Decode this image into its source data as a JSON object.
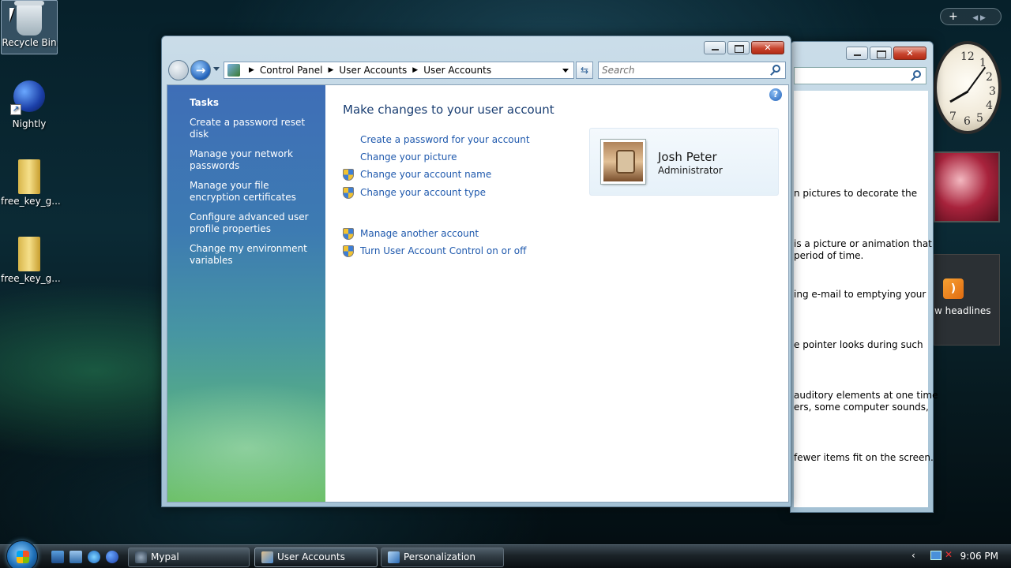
{
  "desktop": {
    "icons": [
      {
        "label": "Recycle Bin"
      },
      {
        "label": "Nightly"
      },
      {
        "label": "free_key_g..."
      },
      {
        "label": "free_key_g..."
      }
    ]
  },
  "gadgets": {
    "add_symbol": "+",
    "clock_numbers": [
      "12",
      "1",
      "2",
      "3",
      "4",
      "5",
      "6",
      "7"
    ],
    "feed_label": "w headlines"
  },
  "background_window": {
    "snippets": [
      "n pictures to decorate the",
      "is a picture or animation that",
      " period of time.",
      "ing e-mail to emptying your",
      "e pointer looks during such",
      "auditory elements at one time",
      "ers, some computer sounds,",
      "fewer items fit on the screen."
    ]
  },
  "main_window": {
    "breadcrumb": [
      "Control Panel",
      "User Accounts",
      "User Accounts"
    ],
    "search_placeholder": "Search",
    "help_symbol": "?",
    "tasks": {
      "heading": "Tasks",
      "links": [
        "Create a password reset disk",
        "Manage your network passwords",
        "Manage your file encryption certificates",
        "Configure advanced user profile properties",
        "Change my environment variables"
      ]
    },
    "heading": "Make changes to your user account",
    "links": [
      {
        "label": "Create a password for your account",
        "shield": false
      },
      {
        "label": "Change your picture",
        "shield": false
      },
      {
        "label": "Change your account name",
        "shield": true
      },
      {
        "label": "Change your account type",
        "shield": true
      }
    ],
    "links2": [
      {
        "label": "Manage another account",
        "shield": true
      },
      {
        "label": "Turn User Account Control on or off",
        "shield": true
      }
    ],
    "user": {
      "name": "Josh Peter",
      "role": "Administrator"
    }
  },
  "taskbar": {
    "buttons": [
      {
        "label": "Mypal",
        "active": false
      },
      {
        "label": "User Accounts",
        "active": true
      },
      {
        "label": "Personalization",
        "active": false
      }
    ],
    "clock": "9:06 PM"
  },
  "colors": {
    "link": "#1f59ad",
    "heading": "#1a3e72"
  }
}
